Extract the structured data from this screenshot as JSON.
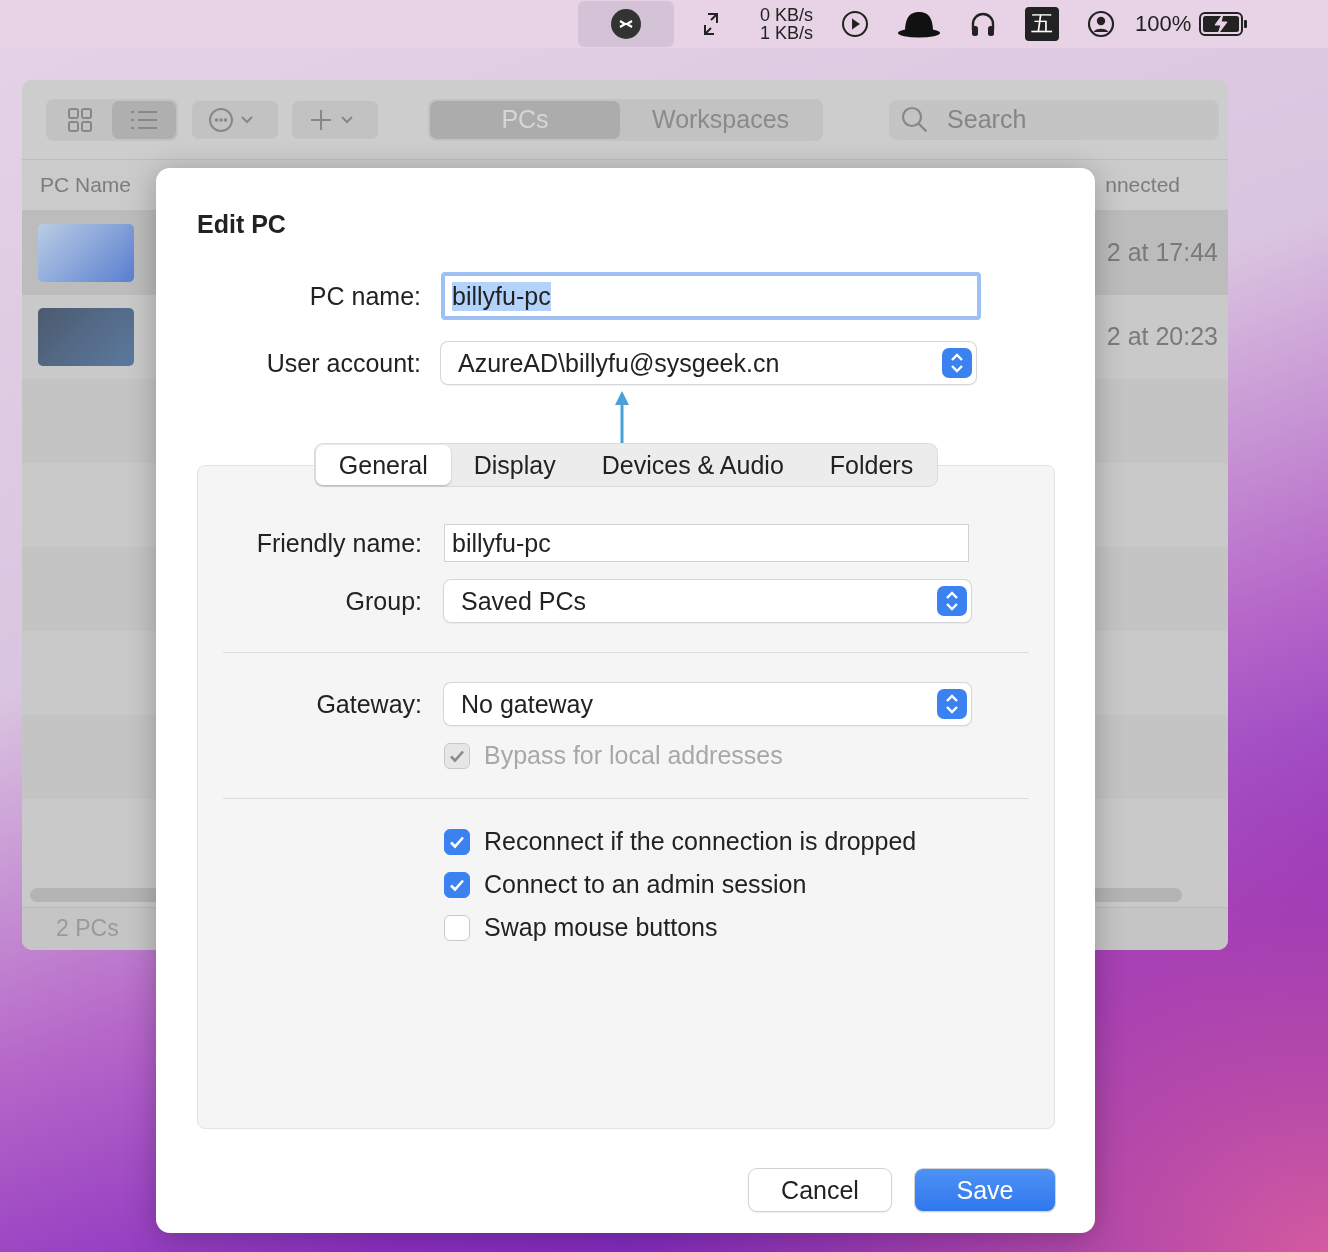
{
  "menu_bar": {
    "net_speed": [
      "0 KB/s",
      "1 KB/s"
    ],
    "input_method": "五",
    "battery": "100%"
  },
  "window": {
    "toolbar": {
      "view_modes": [
        {
          "kind": "grid",
          "selected": false
        },
        {
          "kind": "list",
          "selected": true
        }
      ],
      "segments": [
        {
          "label": "PCs",
          "selected": true
        },
        {
          "label": "Workspaces",
          "selected": false
        }
      ],
      "search": {
        "placeholder": "Search"
      }
    },
    "columns": [
      "PC Name",
      "nnected"
    ],
    "rows": [
      {
        "column_2": "2 at 17:44",
        "selected": true
      },
      {
        "column_2": "2 at 20:23",
        "selected": false
      }
    ],
    "status_bar": "2 PCs"
  },
  "dialog": {
    "title": "Edit PC",
    "fields": [
      {
        "kind": "text",
        "label": "PC name:",
        "value": "billyfu-pc",
        "focused": true
      },
      {
        "kind": "popup",
        "label": "User account:",
        "value": "AzureAD\\billyfu@sysgeek.cn"
      }
    ],
    "tabs": [
      {
        "label": "General",
        "selected": true
      },
      {
        "label": "Display",
        "selected": false
      },
      {
        "label": "Devices & Audio",
        "selected": false
      },
      {
        "label": "Folders",
        "selected": false
      }
    ],
    "panel": [
      {
        "kind": "text",
        "label": "Friendly name:",
        "value": "billyfu-pc"
      },
      {
        "kind": "popup",
        "label": "Group:",
        "value": "Saved PCs"
      },
      {
        "kind": "separator"
      },
      {
        "kind": "popup",
        "label": "Gateway:",
        "value": "No gateway"
      },
      {
        "kind": "checkbox",
        "label": "Bypass for local addresses",
        "checked": true,
        "disabled": true
      },
      {
        "kind": "separator"
      },
      {
        "kind": "checkbox",
        "label": "Reconnect if the connection is dropped",
        "checked": true,
        "disabled": false
      },
      {
        "kind": "checkbox",
        "label": "Connect to an admin session",
        "checked": true,
        "disabled": false
      },
      {
        "kind": "checkbox",
        "label": "Swap mouse buttons",
        "checked": false,
        "disabled": false
      }
    ],
    "buttons": [
      {
        "label": "Cancel",
        "default": false
      },
      {
        "label": "Save",
        "default": true
      }
    ]
  }
}
